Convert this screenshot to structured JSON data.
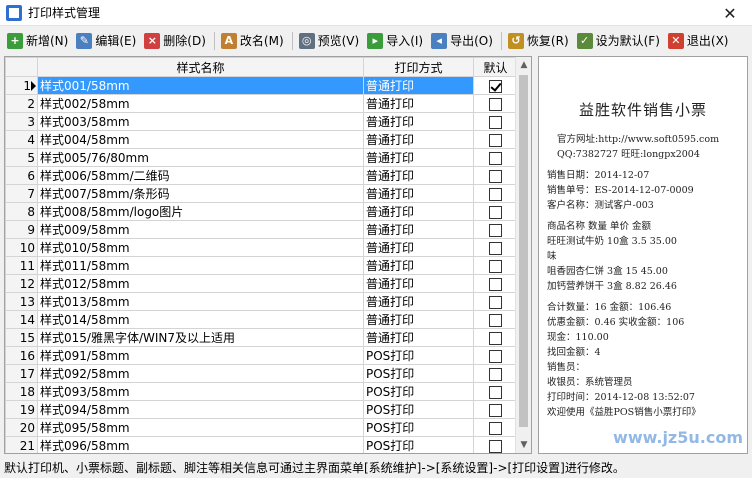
{
  "window": {
    "title": "打印样式管理",
    "close": "✕"
  },
  "toolbar": [
    {
      "label": "新增(N)",
      "icon": "add-icon",
      "color": "#3a9c3a",
      "glyph": "+"
    },
    {
      "label": "编辑(E)",
      "icon": "edit-icon",
      "color": "#4a7fc0",
      "glyph": "✎"
    },
    {
      "label": "删除(D)",
      "icon": "delete-icon",
      "color": "#d04040",
      "glyph": "×"
    },
    {
      "label": "改名(M)",
      "icon": "rename-icon",
      "color": "#c08030",
      "glyph": "A"
    },
    {
      "label": "预览(V)",
      "icon": "preview-icon",
      "color": "#607080",
      "glyph": "◎"
    },
    {
      "label": "导入(I)",
      "icon": "import-icon",
      "color": "#3a9c3a",
      "glyph": "▸"
    },
    {
      "label": "导出(O)",
      "icon": "export-icon",
      "color": "#4a7fc0",
      "glyph": "◂"
    },
    {
      "label": "恢复(R)",
      "icon": "restore-icon",
      "color": "#c09020",
      "glyph": "↺"
    },
    {
      "label": "设为默认(F)",
      "icon": "set-default-icon",
      "color": "#5a8a3a",
      "glyph": "✓"
    },
    {
      "label": "退出(X)",
      "icon": "exit-icon",
      "color": "#d04030",
      "glyph": "✕"
    }
  ],
  "grid": {
    "columns": {
      "name": "样式名称",
      "mode": "打印方式",
      "default": "默认"
    },
    "rows": [
      {
        "num": "1",
        "name": "样式001/58mm",
        "mode": "普通打印",
        "default": true
      },
      {
        "num": "2",
        "name": "样式002/58mm",
        "mode": "普通打印",
        "default": false
      },
      {
        "num": "3",
        "name": "样式003/58mm",
        "mode": "普通打印",
        "default": false
      },
      {
        "num": "4",
        "name": "样式004/58mm",
        "mode": "普通打印",
        "default": false
      },
      {
        "num": "5",
        "name": "样式005/76/80mm",
        "mode": "普通打印",
        "default": false
      },
      {
        "num": "6",
        "name": "样式006/58mm/二维码",
        "mode": "普通打印",
        "default": false
      },
      {
        "num": "7",
        "name": "样式007/58mm/条形码",
        "mode": "普通打印",
        "default": false
      },
      {
        "num": "8",
        "name": "样式008/58mm/logo图片",
        "mode": "普通打印",
        "default": false
      },
      {
        "num": "9",
        "name": "样式009/58mm",
        "mode": "普通打印",
        "default": false
      },
      {
        "num": "10",
        "name": "样式010/58mm",
        "mode": "普通打印",
        "default": false
      },
      {
        "num": "11",
        "name": "样式011/58mm",
        "mode": "普通打印",
        "default": false
      },
      {
        "num": "12",
        "name": "样式012/58mm",
        "mode": "普通打印",
        "default": false
      },
      {
        "num": "13",
        "name": "样式013/58mm",
        "mode": "普通打印",
        "default": false
      },
      {
        "num": "14",
        "name": "样式014/58mm",
        "mode": "普通打印",
        "default": false
      },
      {
        "num": "15",
        "name": "样式015/雅黑字体/WIN7及以上适用",
        "mode": "普通打印",
        "default": false
      },
      {
        "num": "16",
        "name": "样式091/58mm",
        "mode": "POS打印",
        "default": false
      },
      {
        "num": "17",
        "name": "样式092/58mm",
        "mode": "POS打印",
        "default": false
      },
      {
        "num": "18",
        "name": "样式093/58mm",
        "mode": "POS打印",
        "default": false
      },
      {
        "num": "19",
        "name": "样式094/58mm",
        "mode": "POS打印",
        "default": false
      },
      {
        "num": "20",
        "name": "样式095/58mm",
        "mode": "POS打印",
        "default": false
      },
      {
        "num": "21",
        "name": "样式096/58mm",
        "mode": "POS打印",
        "default": false
      }
    ]
  },
  "preview": {
    "title": "益胜软件销售小票",
    "lines": [
      "官方网址:http://www.soft0595.com",
      "QQ:7382727  旺旺:longpx2004",
      "销售日期：2014-12-07",
      "销售单号：ES-2014-12-07-0009",
      "客户名称：测试客户-003",
      "商品名称    数量   单价    金额",
      "旺旺测试牛奶  10盒    3.5   35.00",
      "味",
      "咀香园杏仁饼   3盒     15   45.00",
      "加钙营养饼干   3盒   8.82   26.46",
      "合计数量：16  金额：106.46",
      "优惠金额：0.46  实收金额：106",
      "现金：110.00",
      "找回金额：4",
      "销售员：",
      "收银员：系统管理员",
      "打印时间：2014-12-08 13:52:07",
      "欢迎使用《益胜POS销售小票打印》"
    ],
    "watermark": "www.jz5u.com"
  },
  "status": "默认打印机、小票标题、副标题、脚注等相关信息可通过主界面菜单[系统维护]->[系统设置]->[打印设置]进行修改。"
}
